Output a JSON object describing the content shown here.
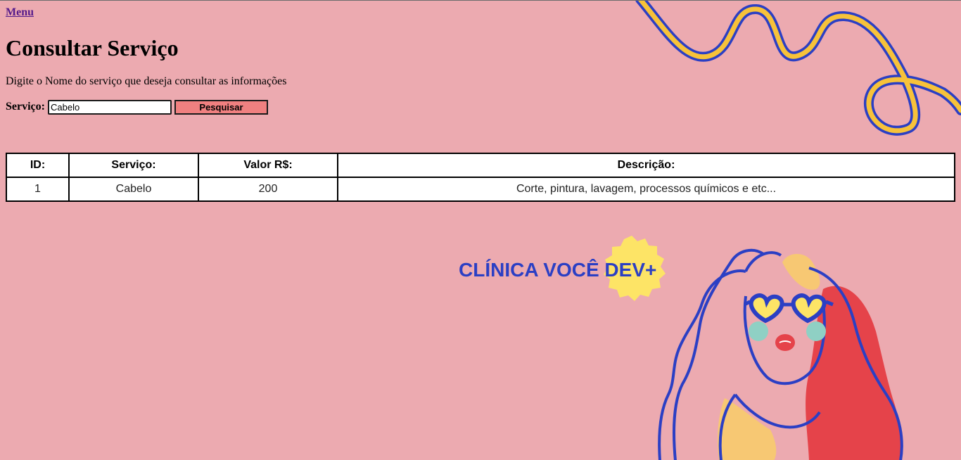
{
  "nav": {
    "menu_label": "Menu"
  },
  "page": {
    "title": "Consultar Serviço",
    "instruction": "Digite o Nome do serviço que deseja consultar as informações"
  },
  "search": {
    "label": "Serviço:",
    "value": "Cabelo",
    "button_label": "Pesquisar"
  },
  "table": {
    "headers": {
      "id": "ID:",
      "servico": "Serviço:",
      "valor": "Valor R$:",
      "descricao": "Descrição:"
    },
    "rows": [
      {
        "id": "1",
        "servico": "Cabelo",
        "valor": "200",
        "descricao": "Corte, pintura, lavagem, processos químicos e etc..."
      }
    ]
  },
  "brand": {
    "text": "CLÍNICA VOCÊ DEV+",
    "illustration": "woman-with-heart-sunglasses-illustration"
  },
  "colors": {
    "background": "#ecaab0",
    "button": "#f08080",
    "brand_blue": "#2b3fc4",
    "accent_yellow": "#f7c23a",
    "hair_red": "#e5434a",
    "badge_yellow": "#fde466"
  }
}
